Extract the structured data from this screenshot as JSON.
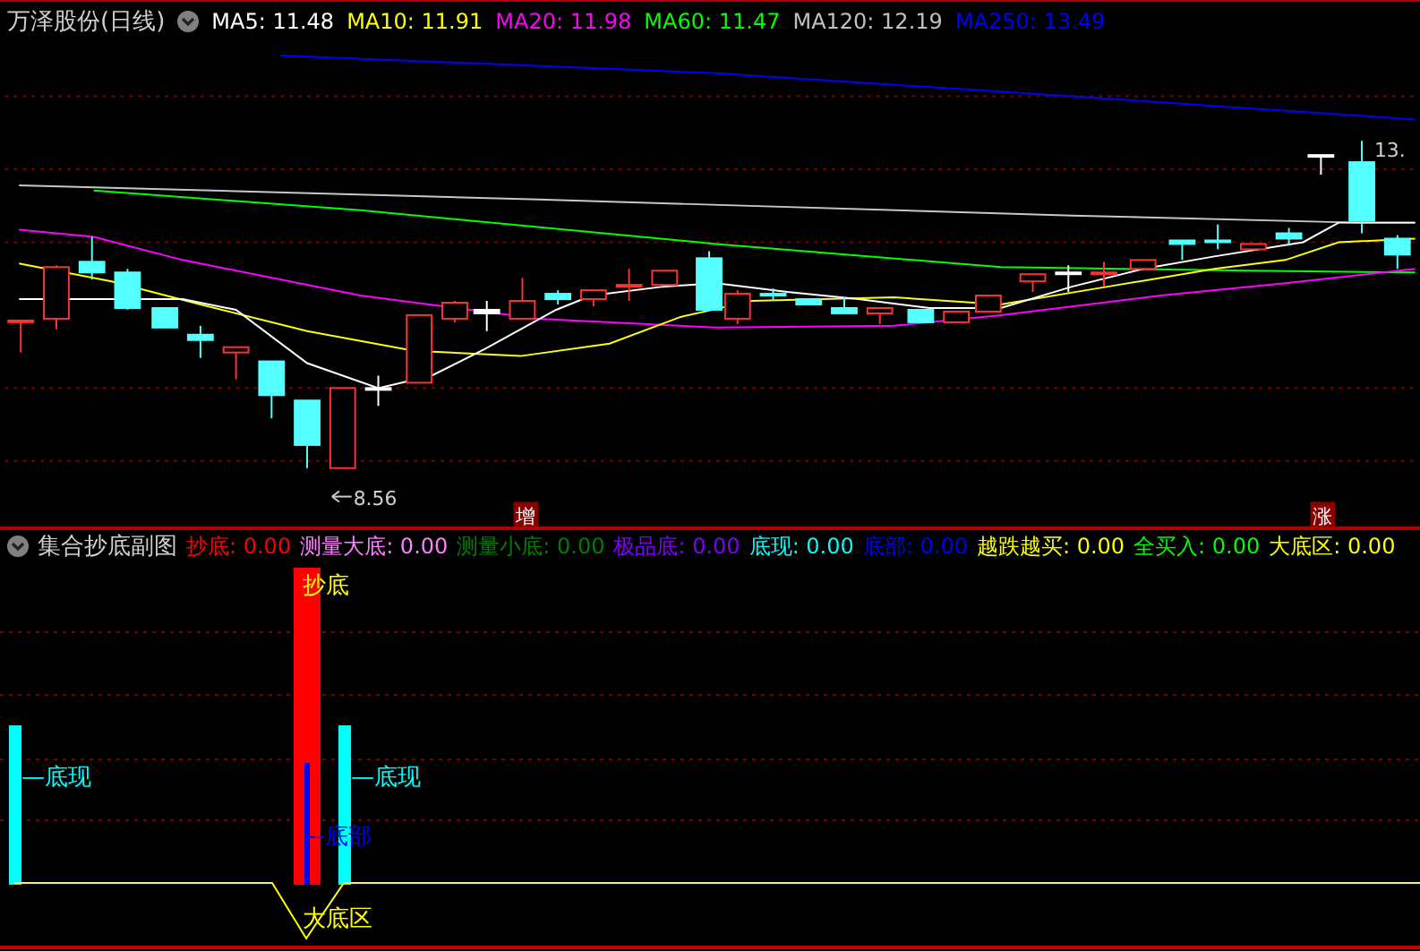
{
  "main_panel": {
    "title": "万泽股份(日线)",
    "indicators": [
      {
        "text": "MA5: 11.48",
        "color": "#ffffff"
      },
      {
        "text": "MA10: 11.91",
        "color": "#ffff00"
      },
      {
        "text": "MA20: 11.98",
        "color": "#ff00ff"
      },
      {
        "text": "MA60: 11.47",
        "color": "#00ff00"
      },
      {
        "text": "MA120: 12.19",
        "color": "#c0c0c0"
      },
      {
        "text": "MA250: 13.49",
        "color": "#0000ff"
      }
    ],
    "price_labels": [
      "8.56",
      "13."
    ],
    "markers": [
      "增",
      "涨"
    ]
  },
  "sub_panel": {
    "title": "集合抄底副图",
    "indicators": [
      {
        "text": "抄底: 0.00",
        "color": "#ff0000"
      },
      {
        "text": "测量大底: 0.00",
        "color": "#ff80ff"
      },
      {
        "text": "测量小底: 0.00",
        "color": "#008000"
      },
      {
        "text": "极品底: 0.00",
        "color": "#8000ff"
      },
      {
        "text": "底现: 0.00",
        "color": "#00ffff"
      },
      {
        "text": "底部: 0.00",
        "color": "#0000ff"
      },
      {
        "text": "越跌越买: 0.00",
        "color": "#ffff00"
      },
      {
        "text": "全买入: 0.00",
        "color": "#00ff00"
      },
      {
        "text": "大底区: 0.00",
        "color": "#ffff00"
      }
    ],
    "annotations": [
      {
        "text": "抄底",
        "color": "#ffff00"
      },
      {
        "text": "—底现",
        "color": "#00ffff"
      },
      {
        "text": "—底现",
        "color": "#00ffff"
      },
      {
        "text": "--底部",
        "color": "#0000ff"
      },
      {
        "text": "大底区",
        "color": "#ffff00"
      }
    ]
  }
}
